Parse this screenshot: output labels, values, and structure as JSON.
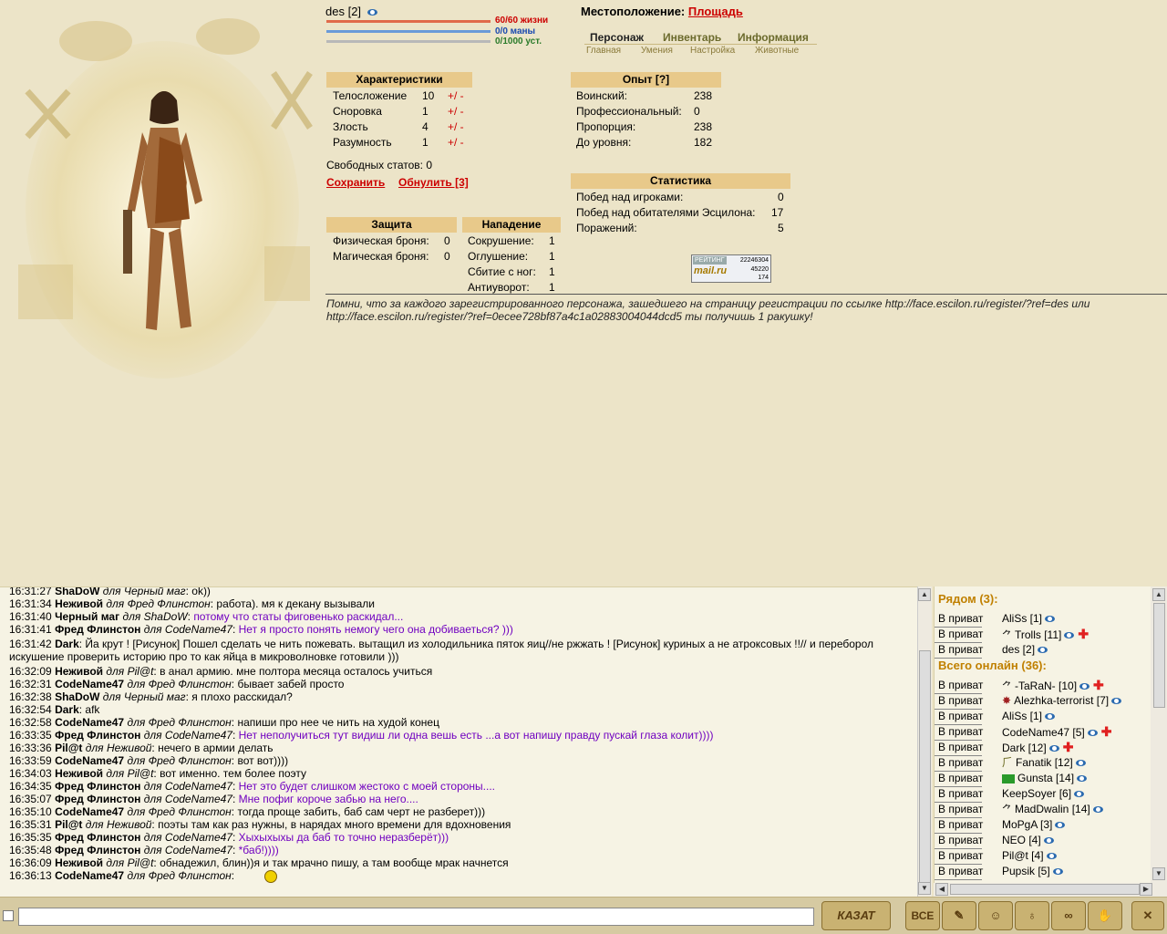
{
  "character": {
    "name": "des",
    "level": "[2]"
  },
  "bars": {
    "hp": "60/60 жизни",
    "mana": "0/0 маны",
    "fatigue": "0/1000 уст."
  },
  "location": {
    "label": "Местоположение:",
    "value": "Площадь"
  },
  "tabs": {
    "main": [
      "Персонаж",
      "Инвентарь",
      "Информация"
    ],
    "sub": [
      "Главная",
      "Умения",
      "Настройка",
      "Животные"
    ]
  },
  "characteristics": {
    "title": "Характеристики",
    "rows": [
      {
        "label": "Телосложение",
        "value": "10"
      },
      {
        "label": "Сноровка",
        "value": "1"
      },
      {
        "label": "Злость",
        "value": "4"
      },
      {
        "label": "Разумность",
        "value": "1"
      }
    ],
    "plus_minus": "+/ -",
    "free_label": "Свободных статов:",
    "free_value": "0",
    "save": "Сохранить",
    "reset": "Обнулить [3]"
  },
  "experience": {
    "title": "Опыт [?]",
    "rows": [
      {
        "label": "Воинский:",
        "value": "238"
      },
      {
        "label": "Профессиональный:",
        "value": "0"
      },
      {
        "label": "Пропорция:",
        "value": "238"
      },
      {
        "label": "До уровня:",
        "value": "182"
      }
    ]
  },
  "statistics": {
    "title": "Статистика",
    "rows": [
      {
        "label": "Побед над игроками:",
        "value": "0"
      },
      {
        "label": "Побед над обитателями Эсцилона:",
        "value": "17"
      },
      {
        "label": "Поражений:",
        "value": "5"
      }
    ]
  },
  "defense": {
    "title": "Защита",
    "rows": [
      {
        "label": "Физическая броня:",
        "value": "0"
      },
      {
        "label": "Магическая броня:",
        "value": "0"
      }
    ]
  },
  "attack": {
    "title": "Нападение",
    "rows": [
      {
        "label": "Сокрушение:",
        "value": "1"
      },
      {
        "label": "Оглушение:",
        "value": "1"
      },
      {
        "label": "Сбитие с ног:",
        "value": "1"
      },
      {
        "label": "Антиуворот:",
        "value": "1"
      }
    ]
  },
  "counter": {
    "top": "РЕЙТИНГ",
    "hits": "22246304",
    "mid": "45220",
    "low": "174",
    "brand": "mail.ru"
  },
  "referral": "Помни, что за каждого зарегистрированного персонажа, зашедшего на страницу регистрации по ссылке http://face.escilon.ru/register/?ref=des или http://face.escilon.ru/register/?ref=0ecee728bf87a4c1a02883004044dcd5 ты получишь 1 ракушку!",
  "chat": [
    {
      "time": "16:31:27",
      "from": "ShaDoW",
      "to": "Черный маг",
      "text": "ok))",
      "priv": false
    },
    {
      "time": "16:31:34",
      "from": "Неживой",
      "to": "Фред Флинстон",
      "text": "работа). мя к декану вызывали",
      "priv": false
    },
    {
      "time": "16:31:40",
      "from": "Черный маг",
      "to": "ShaDoW",
      "text": "потому что статы фиговенько раскидал...",
      "priv": true
    },
    {
      "time": "16:31:41",
      "from": "Фред Флинстон",
      "to": "CodeName47",
      "text": "Нет я просто понять немогу чего она добиваеться? )))",
      "priv": true
    },
    {
      "time": "16:31:42",
      "from": "Dark",
      "to": "",
      "text": "Йа крут ! [Рисунок] Пошел сделать че нить пожевать. вытащил из холодильника пяток яиц//не ржжать ! [Рисунок] куриных а не атроксовых !!// и переборол искушение проверить историю про то как яйца в микроволновке готовили )))",
      "priv": false
    },
    {
      "time": "16:32:09",
      "from": "Неживой",
      "to": "Pil@t",
      "text": "в анал армию. мне полтора месяца осталось учиться",
      "priv": false
    },
    {
      "time": "16:32:31",
      "from": "CodeName47",
      "to": "Фред Флинстон",
      "text": "бывает забей просто",
      "priv": false
    },
    {
      "time": "16:32:38",
      "from": "ShaDoW",
      "to": "Черный маг",
      "text": "я плохо расскидал?",
      "priv": false
    },
    {
      "time": "16:32:54",
      "from": "Dark",
      "to": "",
      "text": "afk",
      "priv": false
    },
    {
      "time": "16:32:58",
      "from": "CodeName47",
      "to": "Фред Флинстон",
      "text": "напиши про нее че нить на худой конец",
      "priv": false
    },
    {
      "time": "16:33:35",
      "from": "Фред Флинстон",
      "to": "CodeName47",
      "text": "Нет неполучиться тут видиш ли одна вешь есть ...а вот напишу правду пускай глаза колит))))",
      "priv": true
    },
    {
      "time": "16:33:36",
      "from": "Pil@t",
      "to": "Неживой",
      "text": "нечего в армии делать",
      "priv": false
    },
    {
      "time": "16:33:59",
      "from": "CodeName47",
      "to": "Фред Флинстон",
      "text": "вот вот))))",
      "priv": false
    },
    {
      "time": "16:34:03",
      "from": "Неживой",
      "to": "Pil@t",
      "text": "вот именно. тем более поэту",
      "priv": false
    },
    {
      "time": "16:34:35",
      "from": "Фред Флинстон",
      "to": "CodeName47",
      "text": "Нет это будет слишком жестоко с моей стороны....",
      "priv": true
    },
    {
      "time": "16:35:07",
      "from": "Фред Флинстон",
      "to": "CodeName47",
      "text": "Мне пофиг короче забью на него....",
      "priv": true
    },
    {
      "time": "16:35:10",
      "from": "CodeName47",
      "to": "Фред Флинстон",
      "text": "тогда проще забить, баб сам черт не разберет)))",
      "priv": false
    },
    {
      "time": "16:35:31",
      "from": "Pil@t",
      "to": "Неживой",
      "text": "поэты там как раз нужны, в нарядах много времени для вдохновения",
      "priv": false
    },
    {
      "time": "16:35:35",
      "from": "Фред Флинстон",
      "to": "CodeName47",
      "text": "Хыхыхыхы да баб то точно неразберёт)))",
      "priv": true
    },
    {
      "time": "16:35:48",
      "from": "Фред Флинстон",
      "to": "CodeName47",
      "text": "*баб!))))",
      "priv": true
    },
    {
      "time": "16:36:09",
      "from": "Неживой",
      "to": "Pil@t",
      "text": "обнадежил, блин))я и так мрачно пишу, а там вообще мрак начнется",
      "priv": false
    },
    {
      "time": "16:36:13",
      "from": "CodeName47",
      "to": "Фред Флинстон",
      "text": "",
      "priv": false
    }
  ],
  "nearby": {
    "title": "Рядом (3):",
    "priv_label": "В приват",
    "users": [
      {
        "name": "AliSs [1]",
        "icon": "",
        "cross": false
      },
      {
        "name": "Trolls [11]",
        "icon": "bird",
        "cross": true
      },
      {
        "name": "des [2]",
        "icon": "",
        "cross": false
      }
    ]
  },
  "online": {
    "title": "Всего онлайн (36):",
    "users": [
      {
        "name": "-TaRaN- [10]",
        "icon": "bird",
        "cross": true
      },
      {
        "name": "Alezhka-terrorist [7]",
        "icon": "bug",
        "cross": false
      },
      {
        "name": "AliSs [1]",
        "icon": "",
        "cross": false
      },
      {
        "name": "CodeName47 [5]",
        "icon": "",
        "cross": true
      },
      {
        "name": "Dark [12]",
        "icon": "",
        "cross": true
      },
      {
        "name": "Fanatik [12]",
        "icon": "clan",
        "cross": false
      },
      {
        "name": "Gunsta [14]",
        "icon": "flag",
        "cross": false
      },
      {
        "name": "KeepSoyer [6]",
        "icon": "",
        "cross": false
      },
      {
        "name": "MadDwalin [14]",
        "icon": "bird",
        "cross": false
      },
      {
        "name": "MoPgA [3]",
        "icon": "",
        "cross": false
      },
      {
        "name": "NEO [4]",
        "icon": "",
        "cross": false
      },
      {
        "name": "Pil@t [4]",
        "icon": "",
        "cross": false
      },
      {
        "name": "Pupsik [5]",
        "icon": "",
        "cross": false
      }
    ]
  },
  "toolbar": {
    "say": "КАЗАТ",
    "all": "ВСЕ"
  }
}
